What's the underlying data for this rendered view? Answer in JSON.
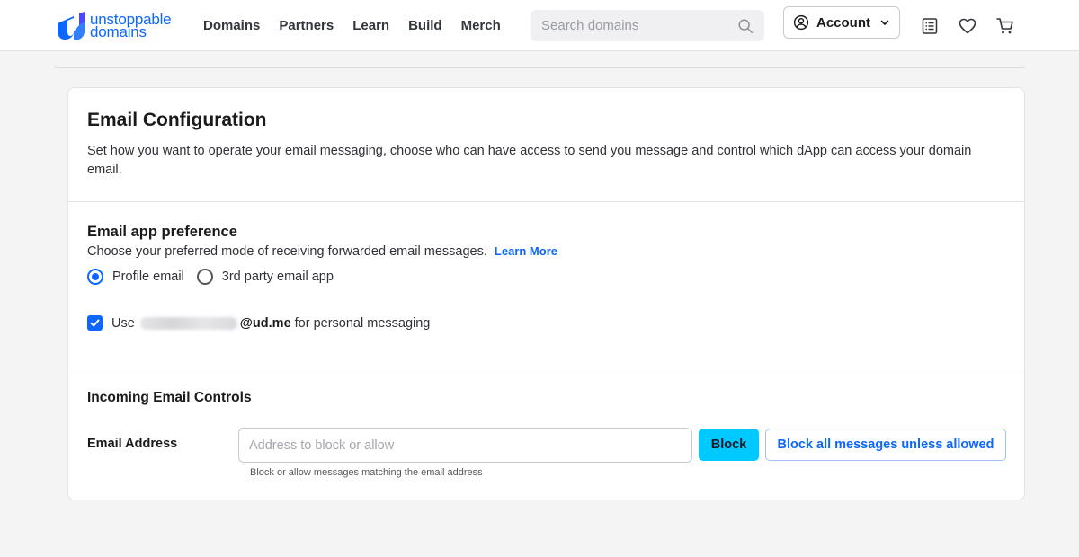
{
  "brand": {
    "logo_line1": "unstoppable",
    "logo_line2": "domains",
    "accent_color": "#0d67fe"
  },
  "nav": {
    "items": [
      {
        "label": "Domains"
      },
      {
        "label": "Partners"
      },
      {
        "label": "Learn"
      },
      {
        "label": "Build"
      },
      {
        "label": "Merch"
      }
    ]
  },
  "search": {
    "placeholder": "Search domains",
    "value": "",
    "icon": "search-icon"
  },
  "account": {
    "label": "Account",
    "icon": "user-circle-icon"
  },
  "header_icons": [
    "receipt-icon",
    "heart-icon",
    "cart-icon"
  ],
  "email_config": {
    "title": "Email Configuration",
    "description": "Set how you want to operate your email messaging, choose who can have access to send you message and control which dApp can access your domain email."
  },
  "app_preference": {
    "title": "Email app preference",
    "description": "Choose your preferred mode of receiving forwarded email messages.",
    "learn_more": "Learn More",
    "options": [
      {
        "label": "Profile email",
        "selected": true
      },
      {
        "label": "3rd party email app",
        "selected": false
      }
    ],
    "personal_messaging": {
      "checked": true,
      "prefix": "Use",
      "domain": "@ud.me",
      "suffix": "for personal messaging"
    }
  },
  "incoming_controls": {
    "title": "Incoming Email Controls",
    "field_label": "Email Address",
    "input_placeholder": "Address to block or allow",
    "input_value": "",
    "helper_text": "Block or allow messages matching the email address",
    "block_button": "Block",
    "block_all_button": "Block all messages unless allowed",
    "block_button_color": "#00c9ff"
  }
}
